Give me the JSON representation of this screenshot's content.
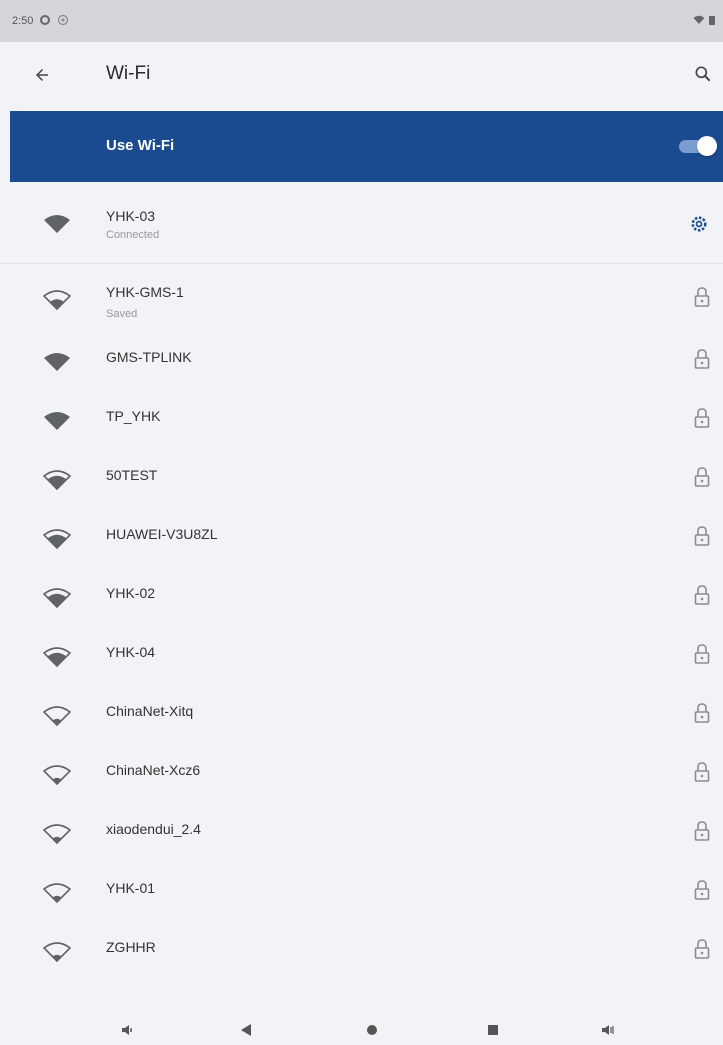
{
  "status_bar": {
    "time": "2:50"
  },
  "app_bar": {
    "title": "Wi-Fi"
  },
  "use_wifi": {
    "label": "Use Wi-Fi",
    "enabled": true
  },
  "connected_network": {
    "name": "YHK-03",
    "status": "Connected"
  },
  "networks": [
    {
      "name": "YHK-GMS-1",
      "status": "Saved",
      "locked": true,
      "signal": "medium"
    },
    {
      "name": "GMS-TPLINK",
      "status": "",
      "locked": true,
      "signal": "full"
    },
    {
      "name": "TP_YHK",
      "status": "",
      "locked": true,
      "signal": "full"
    },
    {
      "name": "50TEST",
      "status": "",
      "locked": true,
      "signal": "high"
    },
    {
      "name": "HUAWEI-V3U8ZL",
      "status": "",
      "locked": true,
      "signal": "high"
    },
    {
      "name": "YHK-02",
      "status": "",
      "locked": true,
      "signal": "high"
    },
    {
      "name": "YHK-04",
      "status": "",
      "locked": true,
      "signal": "high"
    },
    {
      "name": "ChinaNet-Xitq",
      "status": "",
      "locked": true,
      "signal": "low"
    },
    {
      "name": "ChinaNet-Xcz6",
      "status": "",
      "locked": true,
      "signal": "low"
    },
    {
      "name": "xiaodendui_2.4",
      "status": "",
      "locked": true,
      "signal": "low"
    },
    {
      "name": "YHK-01",
      "status": "",
      "locked": true,
      "signal": "low"
    },
    {
      "name": "ZGHHR",
      "status": "",
      "locked": true,
      "signal": "low"
    }
  ],
  "colors": {
    "accent": "#1a4a8f",
    "background": "#f1f3f6",
    "icon": "#5f6368"
  }
}
